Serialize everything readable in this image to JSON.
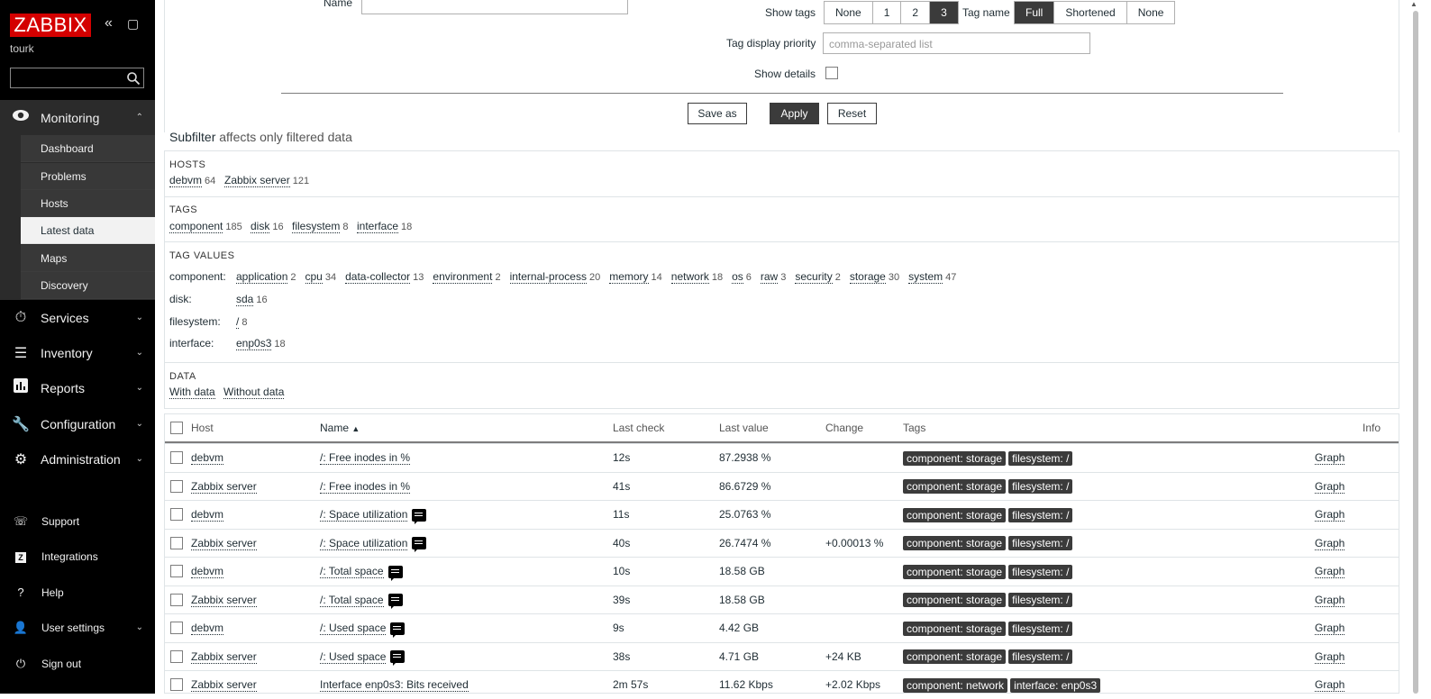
{
  "sidebar": {
    "logo": "ZABBIX",
    "username": "tourk",
    "search_placeholder": "",
    "monitoring": "Monitoring",
    "submenu": [
      "Dashboard",
      "Problems",
      "Hosts",
      "Latest data",
      "Maps",
      "Discovery"
    ],
    "active_submenu": "Latest data",
    "menu": [
      "Services",
      "Inventory",
      "Reports",
      "Configuration",
      "Administration"
    ],
    "bottom": [
      "Support",
      "Integrations",
      "Help",
      "User settings",
      "Sign out"
    ]
  },
  "filter": {
    "name_label": "Name",
    "show_tags_label": "Show tags",
    "show_tags_options": [
      "None",
      "1",
      "2",
      "3"
    ],
    "show_tags_selected": "3",
    "tag_name_label": "Tag name",
    "tag_name_options": [
      "Full",
      "Shortened",
      "None"
    ],
    "tag_name_selected": "Full",
    "tag_priority_label": "Tag display priority",
    "tag_priority_placeholder": "comma-separated list",
    "show_details_label": "Show details",
    "show_details_checked": false,
    "save_as": "Save as",
    "apply": "Apply",
    "reset": "Reset"
  },
  "subfilter": {
    "title": "Subfilter",
    "note": "affects only filtered data",
    "hosts_header": "HOSTS",
    "hosts": [
      {
        "name": "debvm",
        "count": "64"
      },
      {
        "name": "Zabbix server",
        "count": "121"
      }
    ],
    "tags_header": "TAGS",
    "tags": [
      {
        "name": "component",
        "count": "185"
      },
      {
        "name": "disk",
        "count": "16"
      },
      {
        "name": "filesystem",
        "count": "8"
      },
      {
        "name": "interface",
        "count": "18"
      }
    ],
    "tag_values_header": "TAG VALUES",
    "tag_values": [
      {
        "tag": "component:",
        "values": [
          {
            "name": "application",
            "count": "2"
          },
          {
            "name": "cpu",
            "count": "34"
          },
          {
            "name": "data-collector",
            "count": "13"
          },
          {
            "name": "environment",
            "count": "2"
          },
          {
            "name": "internal-process",
            "count": "20"
          },
          {
            "name": "memory",
            "count": "14"
          },
          {
            "name": "network",
            "count": "18"
          },
          {
            "name": "os",
            "count": "6"
          },
          {
            "name": "raw",
            "count": "3"
          },
          {
            "name": "security",
            "count": "2"
          },
          {
            "name": "storage",
            "count": "30"
          },
          {
            "name": "system",
            "count": "47"
          }
        ]
      },
      {
        "tag": "disk:",
        "values": [
          {
            "name": "sda",
            "count": "16"
          }
        ]
      },
      {
        "tag": "filesystem:",
        "values": [
          {
            "name": "/",
            "count": "8"
          }
        ]
      },
      {
        "tag": "interface:",
        "values": [
          {
            "name": "enp0s3",
            "count": "18"
          }
        ]
      }
    ],
    "data_header": "DATA",
    "data": [
      "With data",
      "Without data"
    ]
  },
  "table": {
    "headers": {
      "host": "Host",
      "name": "Name",
      "sort_arrow": "▲",
      "last_check": "Last check",
      "last_value": "Last value",
      "change": "Change",
      "tags": "Tags",
      "info": "Info"
    },
    "rows": [
      {
        "host": "debvm",
        "name": "/: Free inodes in %",
        "hint": false,
        "last_check": "12s",
        "last_value": "87.2938 %",
        "change": "",
        "tags": [
          "component: storage",
          "filesystem: /"
        ],
        "graph": "Graph"
      },
      {
        "host": "Zabbix server",
        "name": "/: Free inodes in %",
        "hint": false,
        "last_check": "41s",
        "last_value": "86.6729 %",
        "change": "",
        "tags": [
          "component: storage",
          "filesystem: /"
        ],
        "graph": "Graph"
      },
      {
        "host": "debvm",
        "name": "/: Space utilization",
        "hint": true,
        "last_check": "11s",
        "last_value": "25.0763 %",
        "change": "",
        "tags": [
          "component: storage",
          "filesystem: /"
        ],
        "graph": "Graph"
      },
      {
        "host": "Zabbix server",
        "name": "/: Space utilization",
        "hint": true,
        "last_check": "40s",
        "last_value": "26.7474 %",
        "change": "+0.00013 %",
        "tags": [
          "component: storage",
          "filesystem: /"
        ],
        "graph": "Graph"
      },
      {
        "host": "debvm",
        "name": "/: Total space",
        "hint": true,
        "last_check": "10s",
        "last_value": "18.58 GB",
        "change": "",
        "tags": [
          "component: storage",
          "filesystem: /"
        ],
        "graph": "Graph"
      },
      {
        "host": "Zabbix server",
        "name": "/: Total space",
        "hint": true,
        "last_check": "39s",
        "last_value": "18.58 GB",
        "change": "",
        "tags": [
          "component: storage",
          "filesystem: /"
        ],
        "graph": "Graph"
      },
      {
        "host": "debvm",
        "name": "/: Used space",
        "hint": true,
        "last_check": "9s",
        "last_value": "4.42 GB",
        "change": "",
        "tags": [
          "component: storage",
          "filesystem: /"
        ],
        "graph": "Graph"
      },
      {
        "host": "Zabbix server",
        "name": "/: Used space",
        "hint": true,
        "last_check": "38s",
        "last_value": "4.71 GB",
        "change": "+24 KB",
        "tags": [
          "component: storage",
          "filesystem: /"
        ],
        "graph": "Graph"
      },
      {
        "host": "Zabbix server",
        "name": "Interface enp0s3: Bits received",
        "hint": false,
        "last_check": "2m 57s",
        "last_value": "11.62 Kbps",
        "change": "+2.02 Kbps",
        "tags": [
          "component: network",
          "interface: enp0s3"
        ],
        "graph": "Graph"
      }
    ]
  }
}
